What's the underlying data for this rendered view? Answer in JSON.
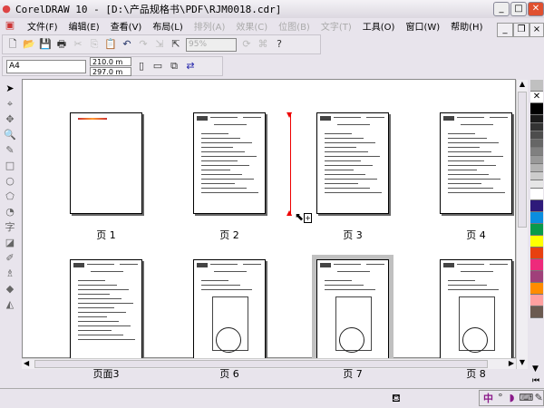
{
  "window": {
    "title": "CorelDRAW 10 - [D:\\产品规格书\\PDF\\RJM0018.cdr]"
  },
  "menu": [
    {
      "label": "文件(F)",
      "enabled": true
    },
    {
      "label": "编辑(E)",
      "enabled": true
    },
    {
      "label": "查看(V)",
      "enabled": true
    },
    {
      "label": "布局(L)",
      "enabled": true
    },
    {
      "label": "排列(A)",
      "enabled": false
    },
    {
      "label": "效果(C)",
      "enabled": false
    },
    {
      "label": "位图(B)",
      "enabled": false
    },
    {
      "label": "文字(T)",
      "enabled": false
    },
    {
      "label": "工具(O)",
      "enabled": true
    },
    {
      "label": "窗口(W)",
      "enabled": true
    },
    {
      "label": "帮助(H)",
      "enabled": true
    }
  ],
  "toolbar": {
    "zoom": "95%"
  },
  "property_bar": {
    "paper": "A4",
    "width": "210.0 m",
    "height": "297.0 m"
  },
  "pages": [
    {
      "label": "页 1"
    },
    {
      "label": "页 2"
    },
    {
      "label": "页 3"
    },
    {
      "label": "页 4"
    },
    {
      "label": "页面3"
    },
    {
      "label": "页 6"
    },
    {
      "label": "页 7",
      "selected": true
    },
    {
      "label": "页 8"
    }
  ],
  "palette": [
    "#c0c0c0",
    "#ffffff",
    "#000000",
    "#1a1a1a",
    "#333333",
    "#4d4d4d",
    "#666666",
    "#808080",
    "#999999",
    "#b3b3b3",
    "#cccccc",
    "#e6e6e6",
    "#ffffff",
    "#2e1a7a",
    "#0a8ee0",
    "#0a9a4a",
    "#ffff00",
    "#e84010",
    "#ee2a7b",
    "#a0407a",
    "#ff8c00",
    "#ffa0a0",
    "#6b5a50"
  ],
  "status": {
    "ime": "中"
  }
}
